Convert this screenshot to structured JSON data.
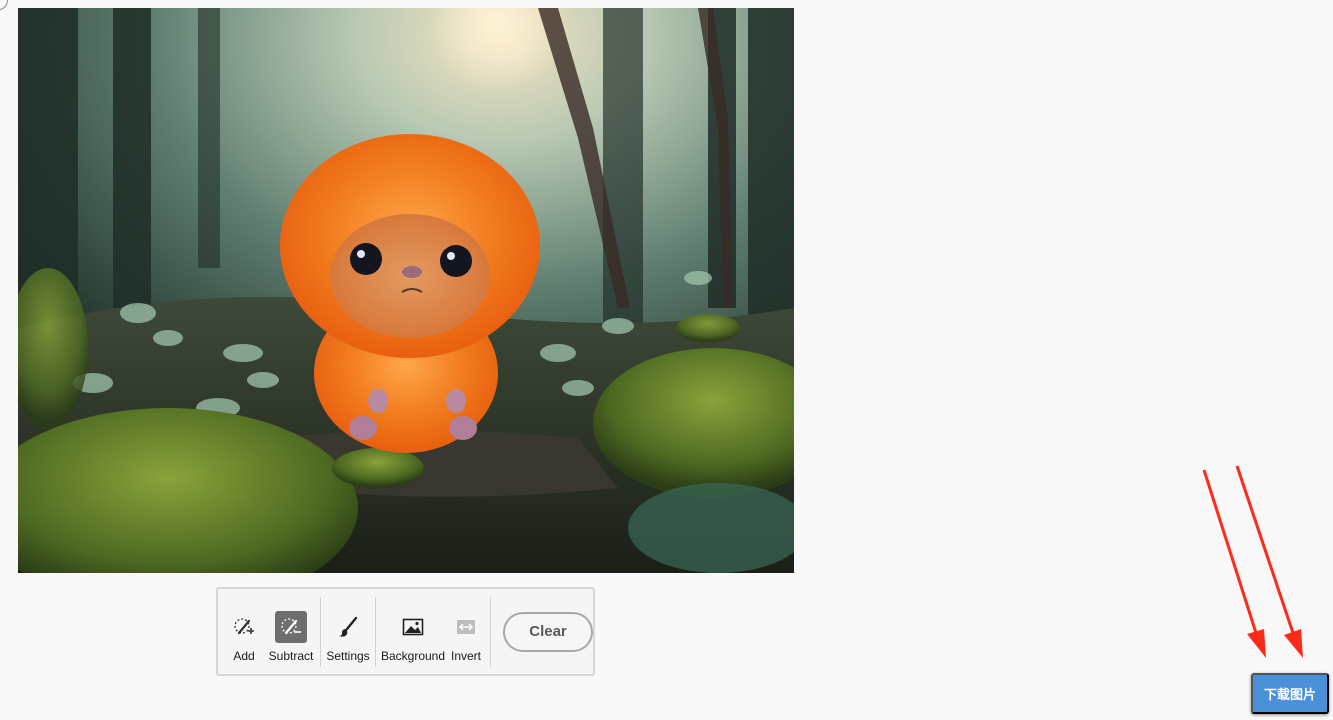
{
  "toolbar": {
    "tools": [
      {
        "label": "Add",
        "icon": "lasso-add-icon",
        "active": false
      },
      {
        "label": "Subtract",
        "icon": "lasso-subtract-icon",
        "active": true
      },
      {
        "label": "Settings",
        "icon": "brush-icon",
        "active": false
      },
      {
        "label": "Background",
        "icon": "image-icon",
        "active": false
      },
      {
        "label": "Invert",
        "icon": "invert-icon",
        "active": false
      }
    ],
    "clear_label": "Clear"
  },
  "download": {
    "label": "下载图片"
  },
  "colors": {
    "page_bg": "#f8f8f8",
    "download_bg": "#4a90d9",
    "annotation_red": "#ff2a1a",
    "active_tool_bg": "#6e6e6e"
  }
}
